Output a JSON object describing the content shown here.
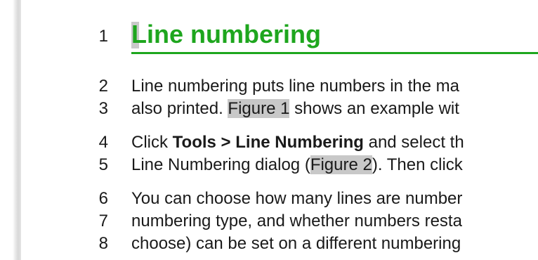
{
  "heading": {
    "number": "1",
    "title": "Line numbering"
  },
  "lines": [
    {
      "number": "2",
      "text": "Line numbering puts line numbers in the ma"
    },
    {
      "number": "3",
      "before": "also printed. ",
      "ref": "Figure 1",
      "after": " shows an example wit"
    },
    {
      "number": "4",
      "before": "Click ",
      "bold": "Tools > Line Numbering",
      "after": " and select th"
    },
    {
      "number": "5",
      "before": "Line Numbering dialog (",
      "ref": "Figure 2",
      "after": "). Then click"
    },
    {
      "number": "6",
      "text": "You can choose how many lines are number"
    },
    {
      "number": "7",
      "text": "numbering type, and whether numbers resta"
    },
    {
      "number": "8",
      "text": "choose) can be set on a different numbering"
    }
  ]
}
